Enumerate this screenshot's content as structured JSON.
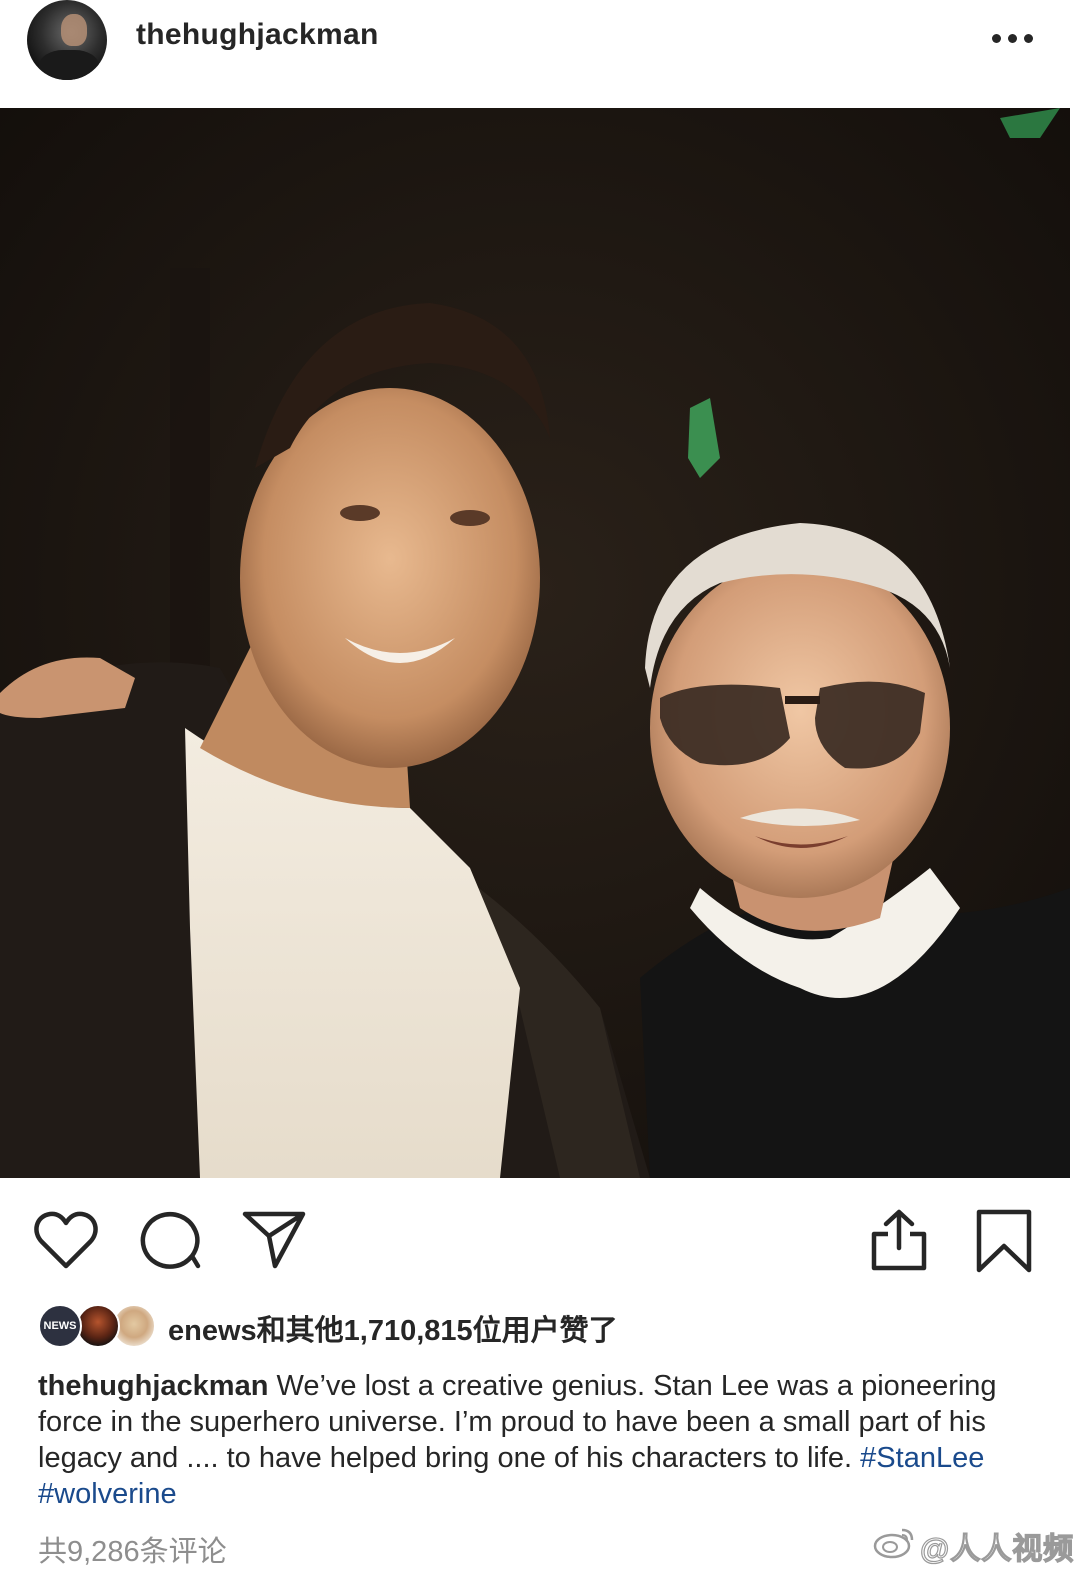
{
  "post": {
    "username": "thehughjackman",
    "more_icon": "more-horizontal-icon",
    "photo_alt": "Photo of two men posing together"
  },
  "actions": {
    "like_icon": "heart-icon",
    "comment_icon": "comment-bubble-icon",
    "share_icon": "paper-plane-icon",
    "upload_icon": "share-upload-icon",
    "save_icon": "bookmark-icon"
  },
  "likes": {
    "liker_badge": "NEWS",
    "text": "enews和其他1,710,815位用户赞了"
  },
  "caption": {
    "username": "thehughjackman",
    "text": " We’ve lost a creative genius. Stan Lee was a pioneering force in the superhero universe. I’m proud to have been a small part of his legacy and .... to have helped bring one of his characters to life. ",
    "hashtag_1": "#StanLee",
    "hashtag_2": "#wolverine"
  },
  "comments": {
    "count_text": "共9,286条评论"
  },
  "watermark": {
    "text": "@人人视频"
  },
  "colors": {
    "text": "#262626",
    "muted": "#8e8e8e",
    "hashtag": "#1a4a8c"
  }
}
